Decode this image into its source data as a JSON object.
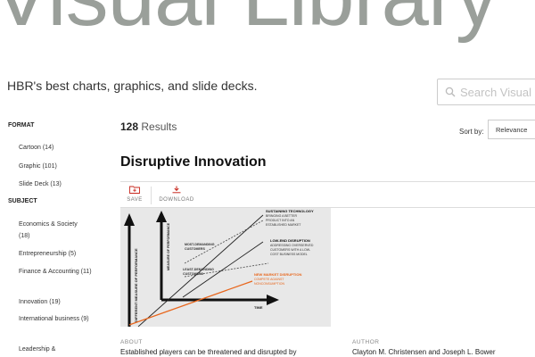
{
  "header": {
    "hero_title": "Visual Library",
    "tagline": "HBR's best charts, graphics, and slide decks.",
    "search_placeholder": "Search Visual"
  },
  "sidebar": {
    "format_heading": "FORMAT",
    "format_items": [
      "Cartoon (14)",
      "Graphic (101)",
      "Slide Deck (13)"
    ],
    "subject_heading": "SUBJECT",
    "subject_items": [
      "Economics & Society (18)",
      "Entrepreneurship (5)",
      "Finance & Accounting (11)",
      "Innovation (19)",
      "International business (9)",
      "Leadership &"
    ]
  },
  "results": {
    "count": "128",
    "label": "Results",
    "sort_label": "Sort by:",
    "sort_value": "Relevance"
  },
  "item": {
    "title": "Disruptive Innovation",
    "save_label": "SAVE",
    "download_label": "DOWNLOAD",
    "graphic": {
      "y_axis": "DIFFERENT MEASURE OF PERFORMANCE",
      "y_axis_2": "MEASURE OF PERFORMANCE",
      "x_axis": "TIME",
      "sustaining_title": "SUSTAINING TECHNOLOGY",
      "sustaining_desc": [
        "BRINGING A BETTER",
        "PRODUCT INTO AN",
        "ESTABLISHED MARKET"
      ],
      "lowend_title": "LOW-END DISRUPTION",
      "lowend_desc": [
        "ADDRESSING OVERSERVED",
        "CUSTOMERS WITH A LOW-",
        "COST BUSINESS MODEL"
      ],
      "most_demanding": [
        "MOST-DEMANDING",
        "CUSTOMERS"
      ],
      "least_demanding": [
        "LEAST-DEMANDING",
        "CUSTOMERS"
      ],
      "new_market_title": "NEW MARKET DISRUPTION",
      "new_market_desc": [
        "COMPETE AGAINST",
        "NONCONSUMPTION"
      ]
    },
    "about_label": "ABOUT",
    "about_text": "Established players can be threatened and disrupted by",
    "author_label": "AUTHOR",
    "author_text": "Clayton M. Christensen and Joseph L. Bower"
  },
  "colors": {
    "accent": "#c8281e",
    "hero": "#9a9f9a",
    "orange": "#e8661c"
  }
}
